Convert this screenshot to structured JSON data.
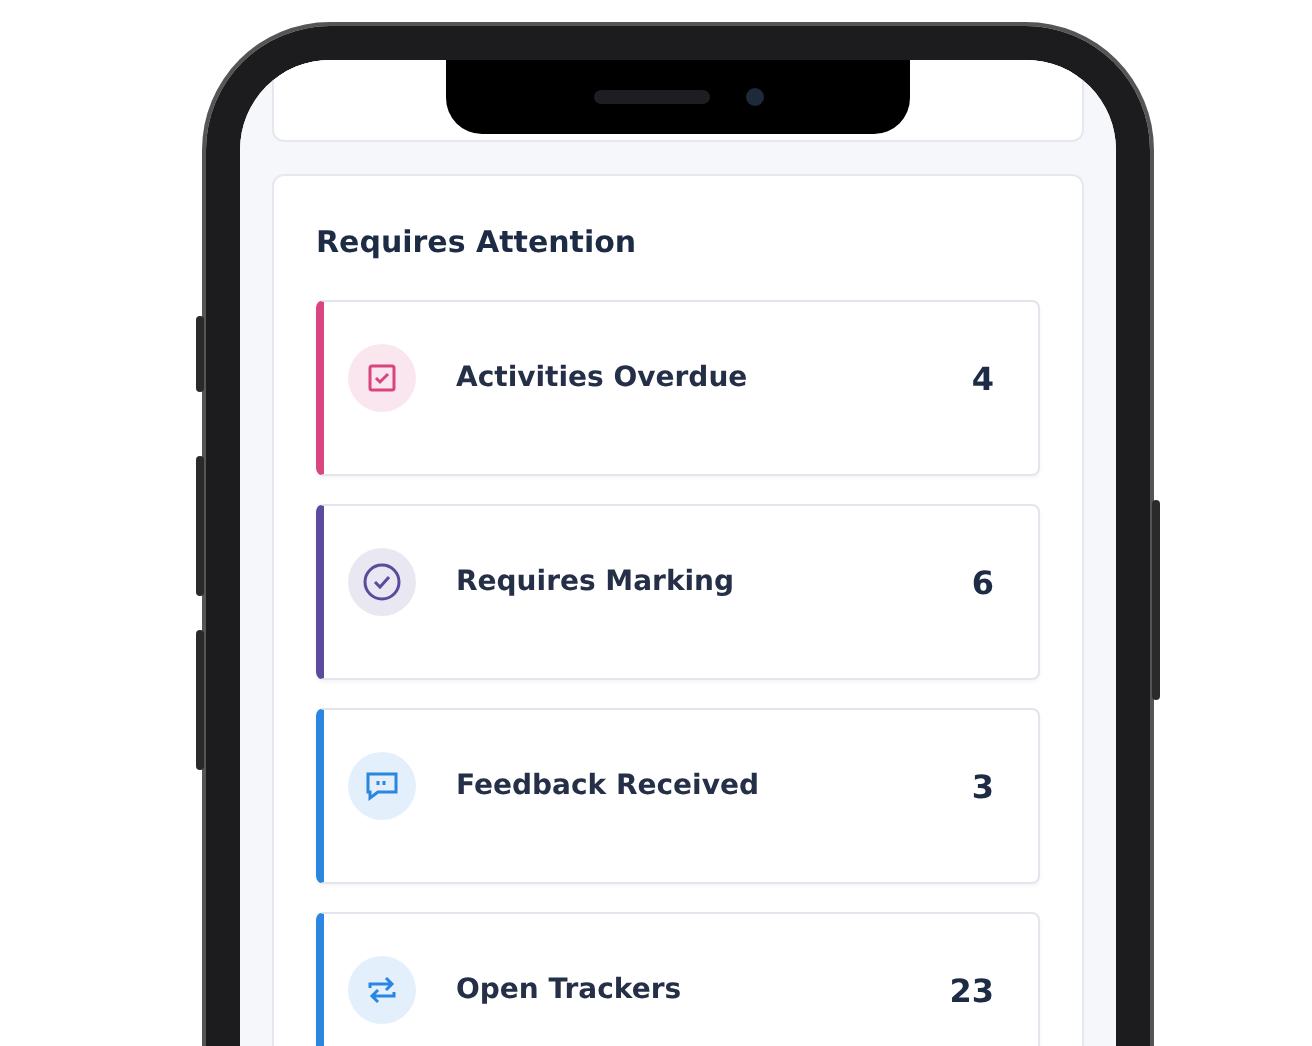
{
  "section": {
    "title": "Requires Attention"
  },
  "items": [
    {
      "kind": "checkbox",
      "label": "Activities Overdue",
      "count": "4",
      "color": "#d9457f"
    },
    {
      "kind": "check-circle",
      "label": "Requires Marking",
      "count": "6",
      "color": "#5b4a9e"
    },
    {
      "kind": "chat",
      "label": "Feedback Received",
      "count": "3",
      "color": "#2a86e0"
    },
    {
      "kind": "repeat",
      "label": "Open Trackers",
      "count": "23",
      "color": "#2a86e0"
    }
  ]
}
